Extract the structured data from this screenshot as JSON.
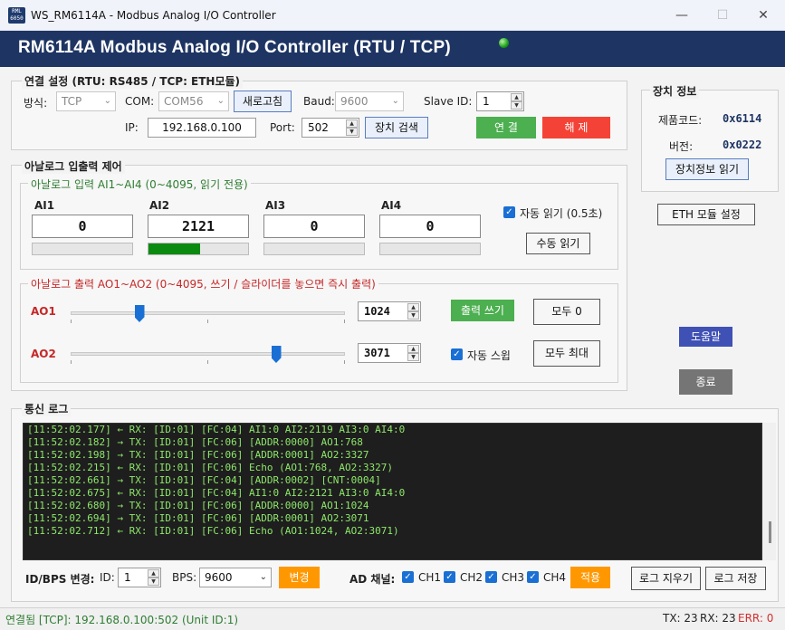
{
  "window": {
    "icon_text": "RML 6050",
    "title": "WS_RM6114A - Modbus Analog I/O Controller",
    "minimize": "—",
    "maximize": "☐",
    "close": "✕"
  },
  "header": {
    "title": "RM6114A  Modbus Analog I/O Controller (RTU / TCP)"
  },
  "connection": {
    "group_label": "연결 설정 (RTU: RS485 / TCP: ETH모듈)",
    "mode_label": "방식:",
    "mode_value": "TCP",
    "com_label": "COM:",
    "com_value": "COM56",
    "refresh_button": "새로고침",
    "baud_label": "Baud:",
    "baud_value": "9600",
    "slave_label": "Slave ID:",
    "slave_value": "1",
    "ip_label": "IP:",
    "ip_value": "192.168.0.100",
    "port_label": "Port:",
    "port_value": "502",
    "scan_button": "장치 검색",
    "connect_button": "연 결",
    "disconnect_button": "해 제"
  },
  "device_info": {
    "group_label": "장치 정보",
    "product_label": "제품코드:",
    "product_value": "0x6114",
    "version_label": "버전:",
    "version_value": "0x0222",
    "read_button": "장치정보 읽기",
    "eth_button": "ETH 모듈 설정"
  },
  "analog": {
    "group_label": "아날로그 입출력 제어",
    "input_label": "아날로그 입력 AI1~AI4 (0~4095, 읽기 전용)",
    "inputs": [
      {
        "label": "AI1",
        "value": "0",
        "level": 0
      },
      {
        "label": "AI2",
        "value": "2121",
        "level": 0.518
      },
      {
        "label": "AI3",
        "value": "0",
        "level": 0
      },
      {
        "label": "AI4",
        "value": "0",
        "level": 0
      }
    ],
    "auto_read_label": "자동 읽기 (0.5초)",
    "manual_read_button": "수동 읽기",
    "output_label": "아날로그 출력 AO1~AO2 (0~4095, 쓰기 / 슬라이더를 놓으면 즉시 출력)",
    "outputs": [
      {
        "label": "AO1",
        "value": "1024",
        "level": 0.25
      },
      {
        "label": "AO2",
        "value": "3071",
        "level": 0.75
      }
    ],
    "write_button": "출력 쓰기",
    "all_zero_button": "모두 0",
    "auto_sweep_label": "자동 스윕",
    "all_max_button": "모두 최대"
  },
  "side": {
    "help_button": "도움말",
    "exit_button": "종료"
  },
  "log": {
    "group_label": "통신 로그",
    "lines": [
      "[11:52:02.177] ← RX: [ID:01] [FC:04] AI1:0 AI2:2119 AI3:0 AI4:0",
      "[11:52:02.182] → TX: [ID:01] [FC:06] [ADDR:0000] AO1:768",
      "[11:52:02.198] → TX: [ID:01] [FC:06] [ADDR:0001] AO2:3327",
      "[11:52:02.215] ← RX: [ID:01] [FC:06] Echo (AO1:768, AO2:3327)",
      "[11:52:02.661] → TX: [ID:01] [FC:04] [ADDR:0002] [CNT:0004]",
      "[11:52:02.675] ← RX: [ID:01] [FC:04] AI1:0 AI2:2121 AI3:0 AI4:0",
      "[11:52:02.680] → TX: [ID:01] [FC:06] [ADDR:0000] AO1:1024",
      "[11:52:02.694] → TX: [ID:01] [FC:06] [ADDR:0001] AO2:3071",
      "[11:52:02.712] ← RX: [ID:01] [FC:06] Echo (AO1:1024, AO2:3071)"
    ]
  },
  "bottom": {
    "idbps_label": "ID/BPS 변경:",
    "id_label": "ID:",
    "id_value": "1",
    "bps_label": "BPS:",
    "bps_value": "9600",
    "change_button": "변경",
    "ad_label": "AD 채널:",
    "channels": [
      "CH1",
      "CH2",
      "CH3",
      "CH4"
    ],
    "apply_button": "적용",
    "clear_log_button": "로그 지우기",
    "save_log_button": "로그 저장"
  },
  "status": {
    "connected_text": "연결됨 [TCP]: 192.168.0.100:502 (Unit ID:1)",
    "tx_text": "TX: 23",
    "rx_text": "RX: 23",
    "err_text": "ERR: 0"
  },
  "colors": {
    "header": "#1e3563",
    "connect": "#4caf50",
    "disconnect": "#f44336",
    "accent_orange": "#ff9800",
    "help": "#3f51b5",
    "exit": "#757575",
    "ai_fill": "#0b8a10",
    "log_text": "#8ee86a"
  }
}
